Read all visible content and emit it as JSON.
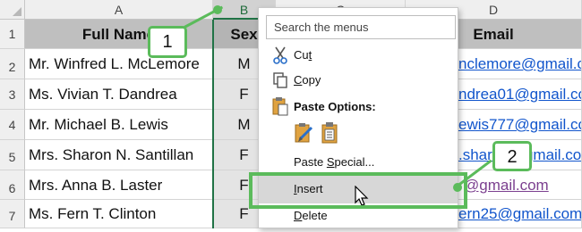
{
  "columns": [
    {
      "letter": "A"
    },
    {
      "letter": "B"
    },
    {
      "letter": "C"
    },
    {
      "letter": "D"
    }
  ],
  "rows": [
    "1",
    "2",
    "3",
    "4",
    "5",
    "6",
    "7"
  ],
  "header": {
    "name": "Full Name",
    "sex": "Sex",
    "email": "Email"
  },
  "records": [
    {
      "name": "Mr. Winfred L. McLemore",
      "sex": "M",
      "email": "nclemore@gmail.com"
    },
    {
      "name": "Ms. Vivian T. Dandrea",
      "sex": "F",
      "email": "ndrea01@gmail.com"
    },
    {
      "name": "Mr. Michael B. Lewis",
      "sex": "M",
      "email": "ewis777@gmail.com"
    },
    {
      "name": "Mrs. Sharon N. Santillan",
      "sex": "F",
      "email": ".sharon@gmail.com"
    },
    {
      "name": "Mrs. Anna B. Laster",
      "sex": "F",
      "email": "@gmail.com"
    },
    {
      "name": "Ms. Fern T. Clinton",
      "sex": "F",
      "email": "ern25@gmail.com"
    }
  ],
  "context_menu": {
    "search_placeholder": "Search the menus",
    "cut": {
      "pre": "Cu",
      "acc": "t",
      "post": ""
    },
    "copy": {
      "pre": "",
      "acc": "C",
      "post": "opy"
    },
    "paste_options": "Paste Options:",
    "paste_special": {
      "pre": "Paste ",
      "acc": "S",
      "post": "pecial..."
    },
    "insert": {
      "pre": "",
      "acc": "I",
      "post": "nsert"
    },
    "delete": {
      "pre": "",
      "acc": "D",
      "post": "elete"
    }
  },
  "callouts": {
    "step1": "1",
    "step2": "2"
  },
  "colors": {
    "accent_green": "#5bbb5b",
    "excel_green": "#217346",
    "link_blue": "#1155cc"
  },
  "icons": [
    "scissors-icon",
    "copy-icon",
    "clipboard-icon",
    "paste-brush-icon",
    "paste-values-icon",
    "mouse-cursor-icon"
  ]
}
